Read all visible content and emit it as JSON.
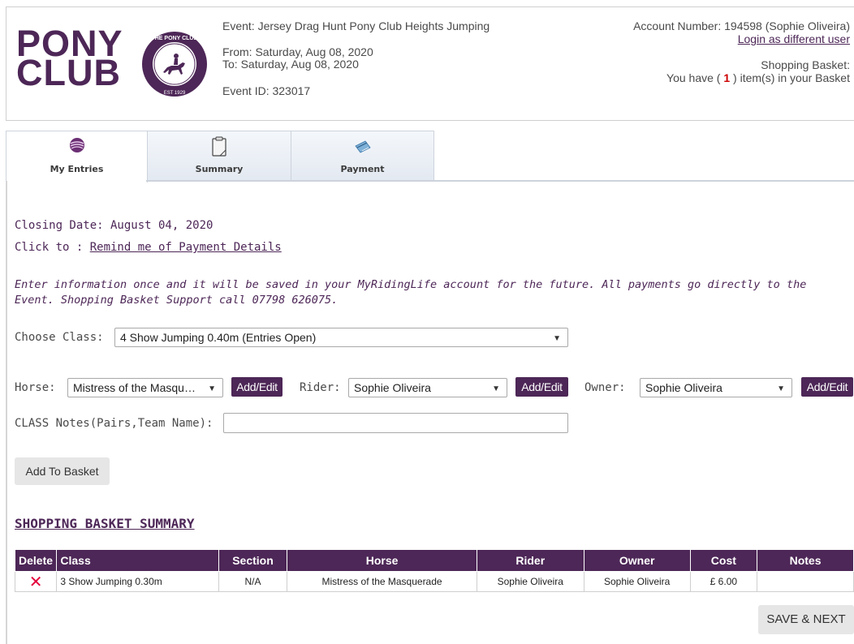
{
  "logo": {
    "line1": "PONY",
    "line2": "CLUB",
    "seal_text": "THE PONY CLUB",
    "seal_est": "EST 1929"
  },
  "event": {
    "name": "Event: Jersey Drag Hunt Pony Club Heights Jumping",
    "from": "From: Saturday, Aug 08, 2020",
    "to": "To: Saturday, Aug 08, 2020",
    "event_id": "Event ID: 323017"
  },
  "account": {
    "number": "Account Number: 194598 (Sophie Oliveira)",
    "login_link": "Login as different user",
    "basket_title": "Shopping Basket:",
    "basket_prefix": "You have ( ",
    "basket_count": "1",
    "basket_suffix": " ) item(s) in your Basket"
  },
  "tabs": [
    {
      "label": "My Entries",
      "icon": "my-entries-icon"
    },
    {
      "label": "Summary",
      "icon": "clipboard-icon"
    },
    {
      "label": "Payment",
      "icon": "payment-card-icon"
    }
  ],
  "closing_date": "Closing Date: August 04, 2020",
  "click_to": "Click to : ",
  "remind_link": "Remind me of Payment Details",
  "info_note": "Enter information once and it will be saved in your MyRidingLife account for the future. All payments go directly to the Event. Shopping Basket Support call 07798 626075.",
  "form": {
    "choose_class_label": "Choose Class:",
    "choose_class_value": "4 Show Jumping 0.40m (Entries Open)",
    "horse_label": "Horse:",
    "horse_value": "Mistress of the Masqu…",
    "rider_label": "Rider:",
    "rider_value": "Sophie Oliveira",
    "owner_label": "Owner:",
    "owner_value": "Sophie Oliveira",
    "add_edit_label": "Add/Edit",
    "class_notes_label": "CLASS Notes(Pairs,Team Name):",
    "class_notes_value": "",
    "add_to_basket": "Add To Basket"
  },
  "basket_summary": {
    "title": "SHOPPING BASKET SUMMARY",
    "columns": [
      "Delete",
      "Class",
      "Section",
      "Horse",
      "Rider",
      "Owner",
      "Cost",
      "Notes"
    ],
    "rows": [
      {
        "class": "3 Show Jumping 0.30m",
        "section": "N/A",
        "horse": "Mistress of the Masquerade",
        "rider": "Sophie Oliveira",
        "owner": "Sophie Oliveira",
        "cost": "£ 6.00",
        "notes": ""
      }
    ]
  },
  "save_next": "SAVE & NEXT",
  "colors": {
    "brand_purple": "#4d2757",
    "delete_red": "#e3003a",
    "count_red": "#cc0000"
  }
}
